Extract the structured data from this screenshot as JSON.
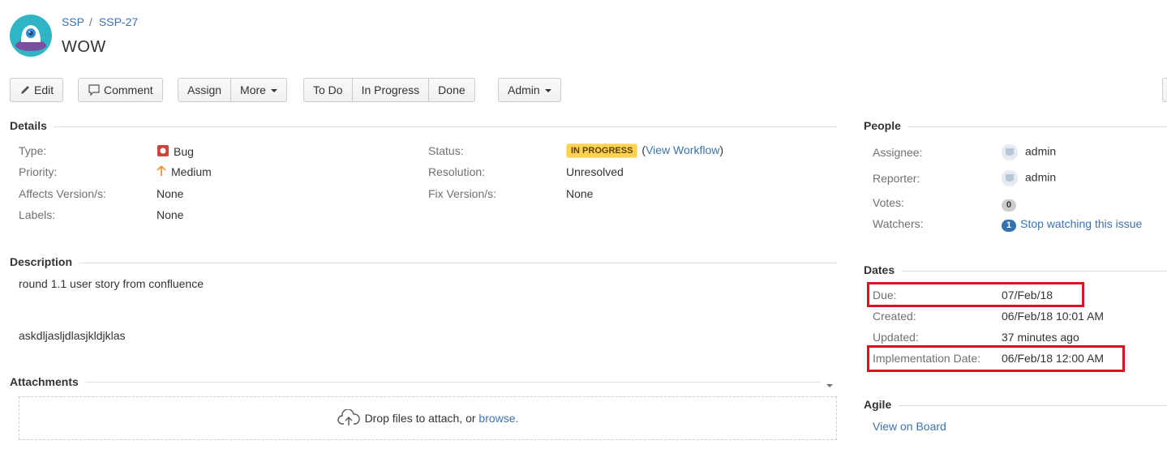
{
  "header": {
    "breadcrumb": {
      "project": "SSP",
      "separator": "/",
      "issue_key": "SSP-27"
    },
    "title": "WOW"
  },
  "toolbar": {
    "edit": "Edit",
    "comment": "Comment",
    "assign": "Assign",
    "more": "More",
    "todo": "To Do",
    "in_progress": "In Progress",
    "done": "Done",
    "admin": "Admin"
  },
  "details": {
    "heading": "Details",
    "type_label": "Type:",
    "type_value": "Bug",
    "priority_label": "Priority:",
    "priority_value": "Medium",
    "affects_label": "Affects Version/s:",
    "affects_value": "None",
    "labels_label": "Labels:",
    "labels_value": "None",
    "status_label": "Status:",
    "status_value": "IN PROGRESS",
    "workflow_open": "(",
    "workflow_link": "View Workflow",
    "workflow_close": ")",
    "resolution_label": "Resolution:",
    "resolution_value": "Unresolved",
    "fix_label": "Fix Version/s:",
    "fix_value": "None"
  },
  "description": {
    "heading": "Description",
    "line1": "round 1.1 user story from confluence",
    "line2": "askdljasljdlasjkldjklas"
  },
  "attachments": {
    "heading": "Attachments",
    "drop_text": "Drop files to attach, or ",
    "browse": "browse."
  },
  "people": {
    "heading": "People",
    "assignee_label": "Assignee:",
    "assignee_value": "admin",
    "reporter_label": "Reporter:",
    "reporter_value": "admin",
    "votes_label": "Votes:",
    "votes_count": "0",
    "watchers_label": "Watchers:",
    "watchers_count": "1",
    "watch_link": "Stop watching this issue"
  },
  "dates": {
    "heading": "Dates",
    "due_label": "Due:",
    "due_value": "07/Feb/18",
    "created_label": "Created:",
    "created_value": "06/Feb/18 10:01 AM",
    "updated_label": "Updated:",
    "updated_value": "37 minutes ago",
    "impl_label": "Implementation Date:",
    "impl_value": "06/Feb/18 12:00 AM"
  },
  "agile": {
    "heading": "Agile",
    "board_link": "View on Board"
  },
  "colors": {
    "link": "#3b73af",
    "highlight": "#d9141e",
    "status": "#ffd351",
    "bug": "#d04437",
    "priority": "#f79232"
  }
}
